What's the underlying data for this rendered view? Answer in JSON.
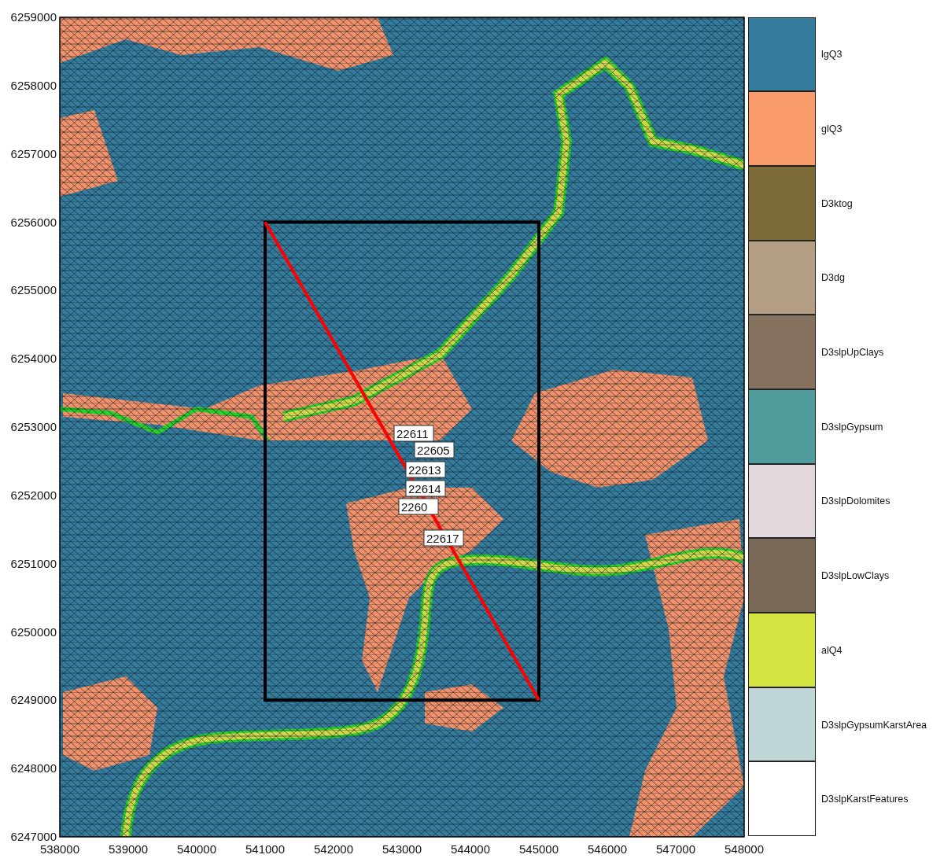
{
  "map": {
    "y_ticks": [
      "6259000",
      "6258000",
      "6257000",
      "6256000",
      "6255000",
      "6254000",
      "6253000",
      "6252000",
      "6251000",
      "6250000",
      "6249000",
      "6248000",
      "6247000"
    ],
    "x_ticks": [
      "538000",
      "539000",
      "540000",
      "541000",
      "542000",
      "543000",
      "544000",
      "545000",
      "546000",
      "547000",
      "548000"
    ],
    "well_labels": [
      {
        "label": "22611"
      },
      {
        "label": "22605"
      },
      {
        "label": "22613"
      },
      {
        "label": "22614"
      },
      {
        "label": "2260"
      },
      {
        "label": "22617"
      }
    ]
  },
  "legend": [
    {
      "label": "lgQ3",
      "color": "#357b9c"
    },
    {
      "label": "glQ3",
      "color": "#f99a6a"
    },
    {
      "label": "D3ktog",
      "color": "#7c6a39"
    },
    {
      "label": "D3dg",
      "color": "#b49f85"
    },
    {
      "label": "D3slpUpClays",
      "color": "#84725f"
    },
    {
      "label": "D3slpGypsum",
      "color": "#529b9d"
    },
    {
      "label": "D3slpDolomites",
      "color": "#e3d8de"
    },
    {
      "label": "D3slpLowClays",
      "color": "#7a6858"
    },
    {
      "label": "alQ4",
      "color": "#d3e33f"
    },
    {
      "label": "D3slpGypsumKarstArea",
      "color": "#c0d5d6"
    },
    {
      "label": "D3slpKarstFeatures",
      "color": "#ffffff"
    }
  ]
}
